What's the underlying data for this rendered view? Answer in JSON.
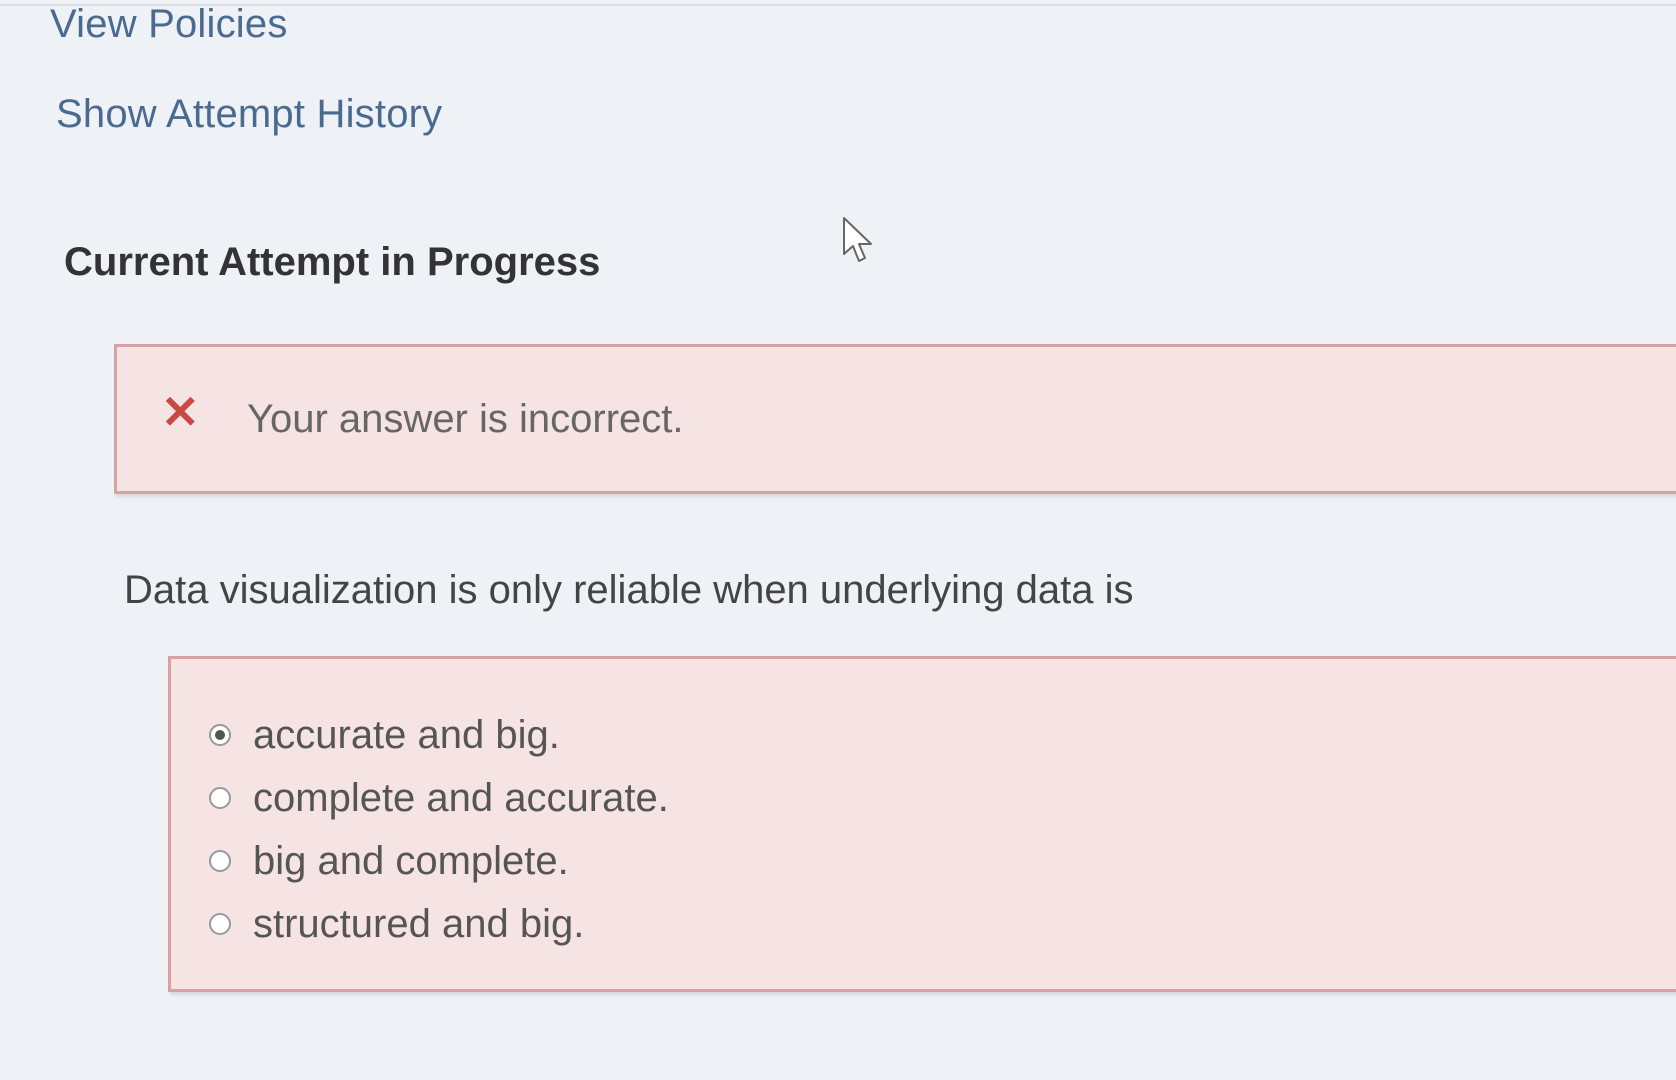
{
  "nav": {
    "view_policies": "View Policies",
    "show_attempt_history": "Show Attempt History"
  },
  "section": {
    "title": "Current Attempt in Progress"
  },
  "feedback": {
    "icon": "x-icon",
    "message": "Your answer is incorrect.",
    "color": "#c94a45",
    "background": "#f6e4e5"
  },
  "question": {
    "prompt": "Data visualization is only reliable when underlying data is",
    "choices": [
      {
        "label": "accurate and big.",
        "selected": true
      },
      {
        "label": "complete and accurate.",
        "selected": false
      },
      {
        "label": "big and complete.",
        "selected": false
      },
      {
        "label": "structured and big.",
        "selected": false
      }
    ]
  }
}
